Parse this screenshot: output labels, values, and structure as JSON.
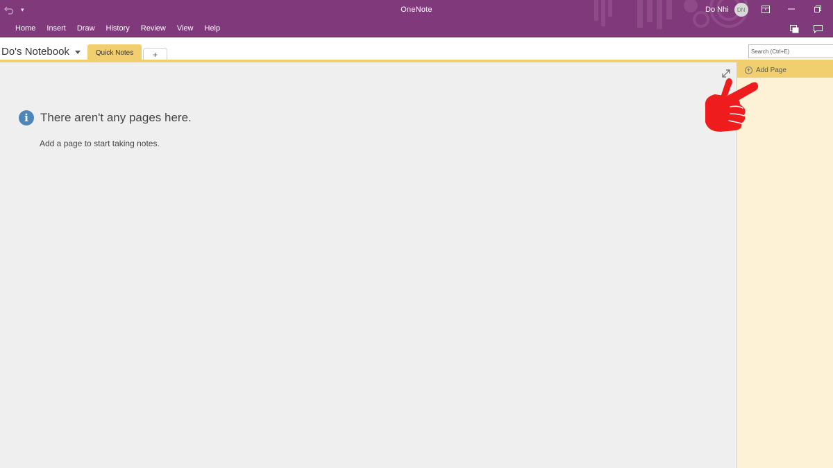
{
  "window": {
    "title": "OneNote",
    "user_name": "Do Nhi",
    "user_initials": "DN"
  },
  "menu": [
    "Home",
    "Insert",
    "Draw",
    "History",
    "Review",
    "View",
    "Help"
  ],
  "notebook": {
    "name": "Do's Notebook",
    "section_tab": "Quick Notes",
    "add_section_label": "+"
  },
  "search": {
    "placeholder": "Search (Ctrl+E)"
  },
  "content": {
    "empty_title": "There aren't any pages here.",
    "empty_hint": "Add a page to start taking notes."
  },
  "page_pane": {
    "add_page_label": "Add Page"
  },
  "colors": {
    "accent": "#80397b",
    "section": "#f2cf6e",
    "info": "#4f86b9"
  }
}
